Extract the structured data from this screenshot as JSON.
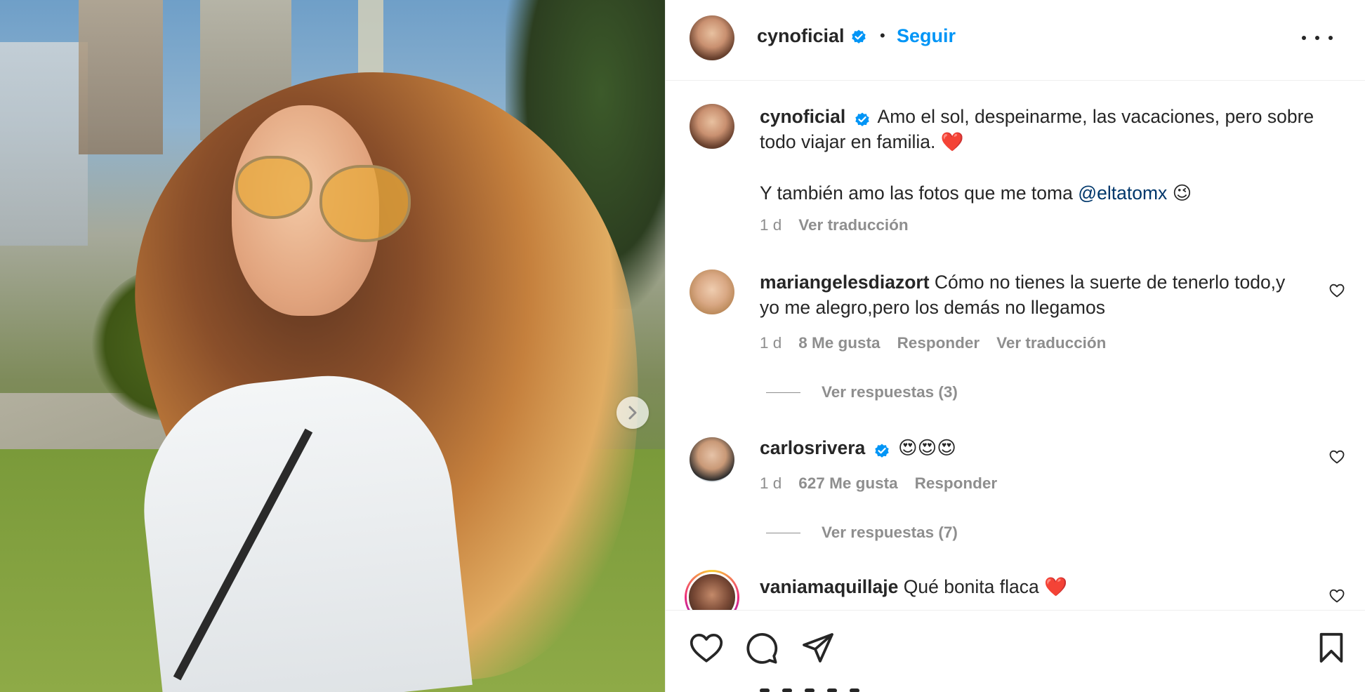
{
  "post": {
    "author": "cynoficial",
    "follow_label": "Seguir",
    "caption_line1": "Amo el sol, despeinarme, las vacaciones, pero sobre todo viajar en familia.",
    "caption_heart": "❤️",
    "caption_line2_prefix": "Y también amo las fotos que me toma",
    "caption_mention": "@eltatomx",
    "caption_wink": "😉",
    "time": "1 d",
    "translate_label": "Ver traducción"
  },
  "comments": [
    {
      "user": "mariangelesdiazort",
      "text": "Cómo no tienes la suerte de tenerlo todo,y yo me alegro,pero los demás no llegamos",
      "time": "1 d",
      "likes": "8 Me gusta",
      "reply_label": "Responder",
      "translate_label": "Ver traducción",
      "view_replies": "Ver respuestas (3)"
    },
    {
      "user": "carlosrivera",
      "verified": true,
      "text": "😍😍😍",
      "time": "1 d",
      "likes": "627 Me gusta",
      "reply_label": "Responder",
      "view_replies": "Ver respuestas (7)"
    },
    {
      "user": "vaniamaquillaje",
      "text": "Qué bonita flaca",
      "heart": "❤️"
    }
  ],
  "icons": {
    "verified": "verified-badge-icon",
    "more": "more-options-icon",
    "like": "heart-icon",
    "comment": "comment-icon",
    "share": "paper-plane-icon",
    "save": "bookmark-icon",
    "next": "chevron-right-icon"
  },
  "colors": {
    "link": "#0095f6",
    "mention": "#00376b",
    "muted": "#8e8e8e",
    "text": "#262626"
  }
}
